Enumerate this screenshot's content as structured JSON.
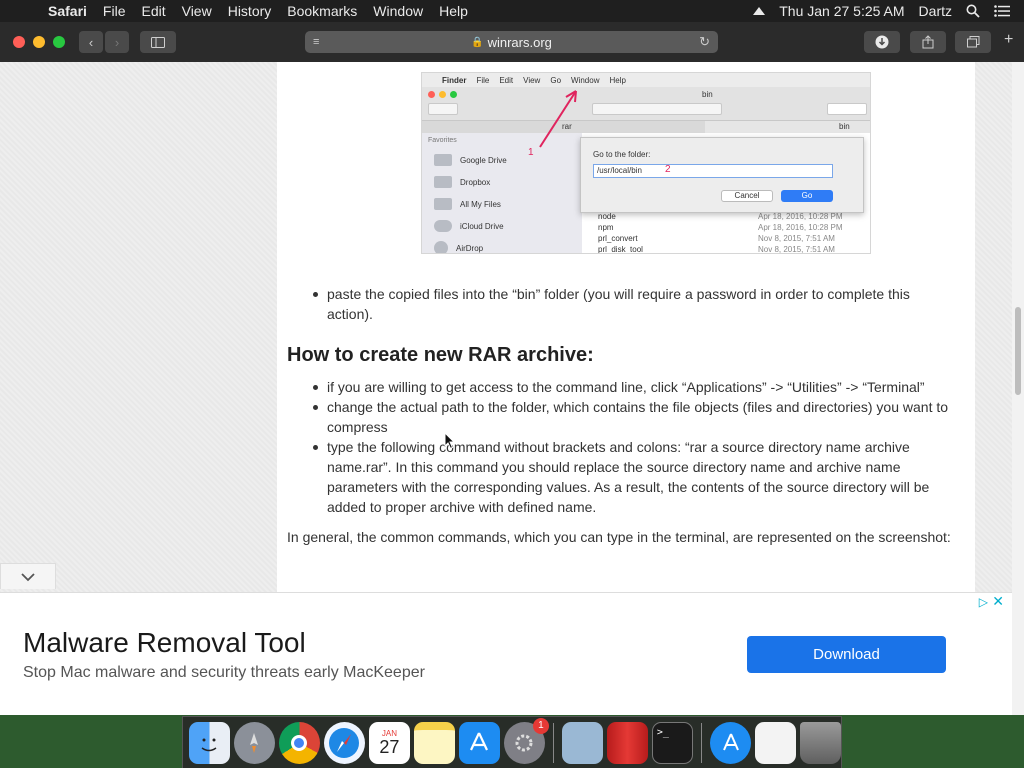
{
  "menubar": {
    "app": "Safari",
    "items": [
      "File",
      "Edit",
      "View",
      "History",
      "Bookmarks",
      "Window",
      "Help"
    ],
    "clock": "Thu Jan 27  5:25 AM",
    "user": "Dartz"
  },
  "toolbar": {
    "url": "winrars.org"
  },
  "screenshot": {
    "menu": [
      "Finder",
      "File",
      "Edit",
      "View",
      "Go",
      "Window",
      "Help"
    ],
    "folder": "bin",
    "path_header": "rar",
    "path_header2": "bin",
    "favorites_label": "Favorites",
    "sidebar": [
      "Google Drive",
      "Dropbox",
      "All My Files",
      "iCloud Drive",
      "AirDrop"
    ],
    "files": [
      {
        "name": "node",
        "date": "Apr 18, 2016, 10:28 PM"
      },
      {
        "name": "npm",
        "date": "Apr 18, 2016, 10:28 PM"
      },
      {
        "name": "prl_convert",
        "date": "Nov 8, 2015, 7:51 AM"
      },
      {
        "name": "prl_disk_tool",
        "date": "Nov 8, 2015, 7:51 AM"
      }
    ],
    "dialog_label": "Go to the folder:",
    "dialog_value": "/usr/local/bin",
    "cancel": "Cancel",
    "go": "Go",
    "mark1": "1",
    "mark2": "2"
  },
  "article": {
    "bullet_paste_1": "paste the copied files into the “bin” folder (you will require a password in order to complete this",
    "bullet_paste_2": "action).",
    "heading": "How to create new RAR archive:",
    "b1": "if you are willing to get access to the command line, click “Applications” -> “Utilities” -> “Terminal”",
    "b2_1": "change the actual path to the folder, which contains the file objects (files and directories) you want to",
    "b2_2": "compress",
    "b3_1": "type the following command without brackets and colons: “rar a source directory name archive",
    "b3_2": "name.rar”. In this command you should replace the source directory name and archive name",
    "b3_3": "parameters with the corresponding values. As a result, the contents of the source directory will be",
    "b3_4": "added to proper archive with defined name.",
    "para": "In general, the common commands, which you can type in the terminal, are represented on the screenshot:"
  },
  "ad": {
    "title": "Malware Removal Tool",
    "subtitle": "Stop Mac malware and security threats early MacKeeper",
    "button": "Download"
  },
  "dock": {
    "calendar_month": "JAN",
    "calendar_day": "27",
    "badge": "1"
  }
}
